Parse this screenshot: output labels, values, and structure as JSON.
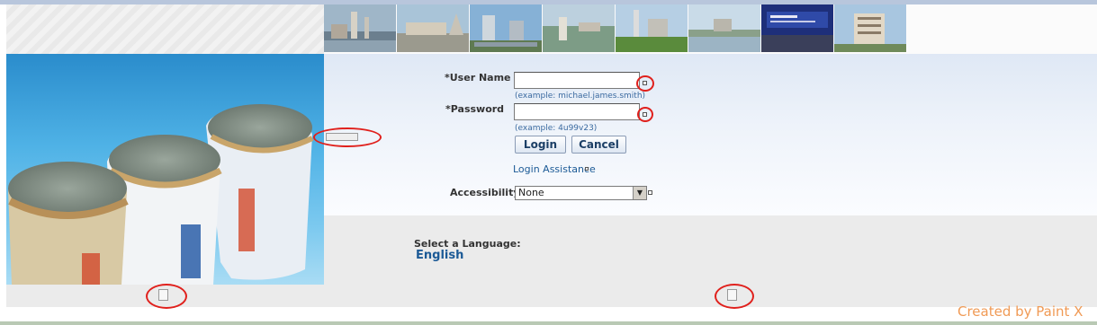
{
  "login": {
    "username_label": "*User Name",
    "username_value": "",
    "username_hint": "(example: michael.james.smith)",
    "password_label": "*Password",
    "password_value": "",
    "password_hint": "(example: 4u99v23)",
    "login_button": "Login",
    "cancel_button": "Cancel",
    "assistance_link": "Login Assistance",
    "accessibility_label": "Accessibility",
    "accessibility_value": "None"
  },
  "language": {
    "label": "Select a Language:",
    "option": "English"
  },
  "watermark": "Created by Paint X",
  "header_photos": [
    "cement-plant-photo",
    "plant-entrance-photo",
    "city-buildings-photo",
    "aerial-plant-photo",
    "factory-chimney-photo",
    "river-plant-photo",
    "company-banner-photo",
    "hotel-building-photo"
  ],
  "colors": {
    "accent_link": "#1c5a96",
    "annotation": "#e0201c",
    "watermark": "#f09a55"
  }
}
